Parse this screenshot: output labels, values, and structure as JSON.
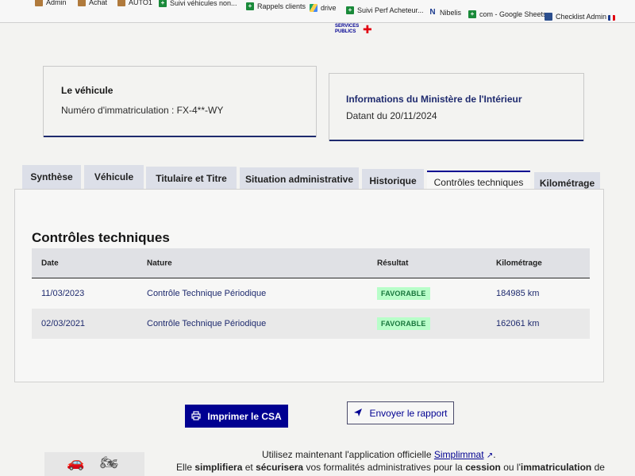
{
  "bookmarks": [
    {
      "label": "Admin",
      "icon": "folder-icon"
    },
    {
      "label": "Achat",
      "icon": "folder-icon"
    },
    {
      "label": "AUTO1",
      "icon": "folder-icon"
    },
    {
      "label": "Suivi véhicules non...",
      "icon": "sheets-icon"
    },
    {
      "label": "Rappels clients",
      "icon": "sheets-icon"
    },
    {
      "label": "drive",
      "icon": "drive-icon"
    },
    {
      "label": "Suivi Perf Acheteur...",
      "icon": "sheets-icon"
    },
    {
      "label": "Nibelis",
      "icon": "nibelis-icon"
    },
    {
      "label": "com - Google Sheets",
      "icon": "sheets-icon"
    },
    {
      "label": "Checklist Admin",
      "icon": "table-icon"
    }
  ],
  "logo": {
    "line1": "SERVICES",
    "line2": "PUBLICS"
  },
  "vehicle_card": {
    "title": "Le véhicule",
    "plate_text": "Numéro d'immatriculation : FX-4**-WY"
  },
  "ministry_card": {
    "title": "Informations du Ministère de l'Intérieur",
    "date_text": "Datant du 20/11/2024"
  },
  "tabs": [
    {
      "label": "Synthèse",
      "active": false
    },
    {
      "label": "Véhicule",
      "active": false
    },
    {
      "label": "Titulaire et Titre",
      "active": false
    },
    {
      "label": "Situation administrative",
      "active": false
    },
    {
      "label": "Historique",
      "active": false
    },
    {
      "label": "Contrôles techniques",
      "active": true
    },
    {
      "label": "Kilométrage",
      "active": false
    }
  ],
  "section_title": "Contrôles techniques",
  "table": {
    "columns": [
      "Date",
      "Nature",
      "Résultat",
      "Kilométrage"
    ],
    "rows": [
      {
        "date": "11/03/2023",
        "nature": "Contrôle Technique Périodique",
        "result": "FAVORABLE",
        "km": "184985 km"
      },
      {
        "date": "02/03/2021",
        "nature": "Contrôle Technique Périodique",
        "result": "FAVORABLE",
        "km": "162061 km"
      }
    ]
  },
  "buttons": {
    "print_label": "Imprimer le CSA",
    "send_label": "Envoyer le rapport"
  },
  "promo": {
    "line1_prefix": "Utilisez maintenant l'application officielle ",
    "line1_link": "Simplimmat",
    "line1_suffix": ".",
    "line2_part1": "Elle ",
    "line2_bold1": "simplifiera",
    "line2_part2": " et ",
    "line2_bold2": "sécurisera",
    "line2_part3": " vos formalités administratives pour la ",
    "line2_bold3": "cession",
    "line2_part4": " ou l'",
    "line2_bold4": "immatriculation",
    "line2_part5": " de"
  },
  "colors": {
    "primary_blue": "#000091",
    "success_bg": "#b8fec9",
    "success_text": "#18753c",
    "marianne_red": "#e1000f"
  }
}
